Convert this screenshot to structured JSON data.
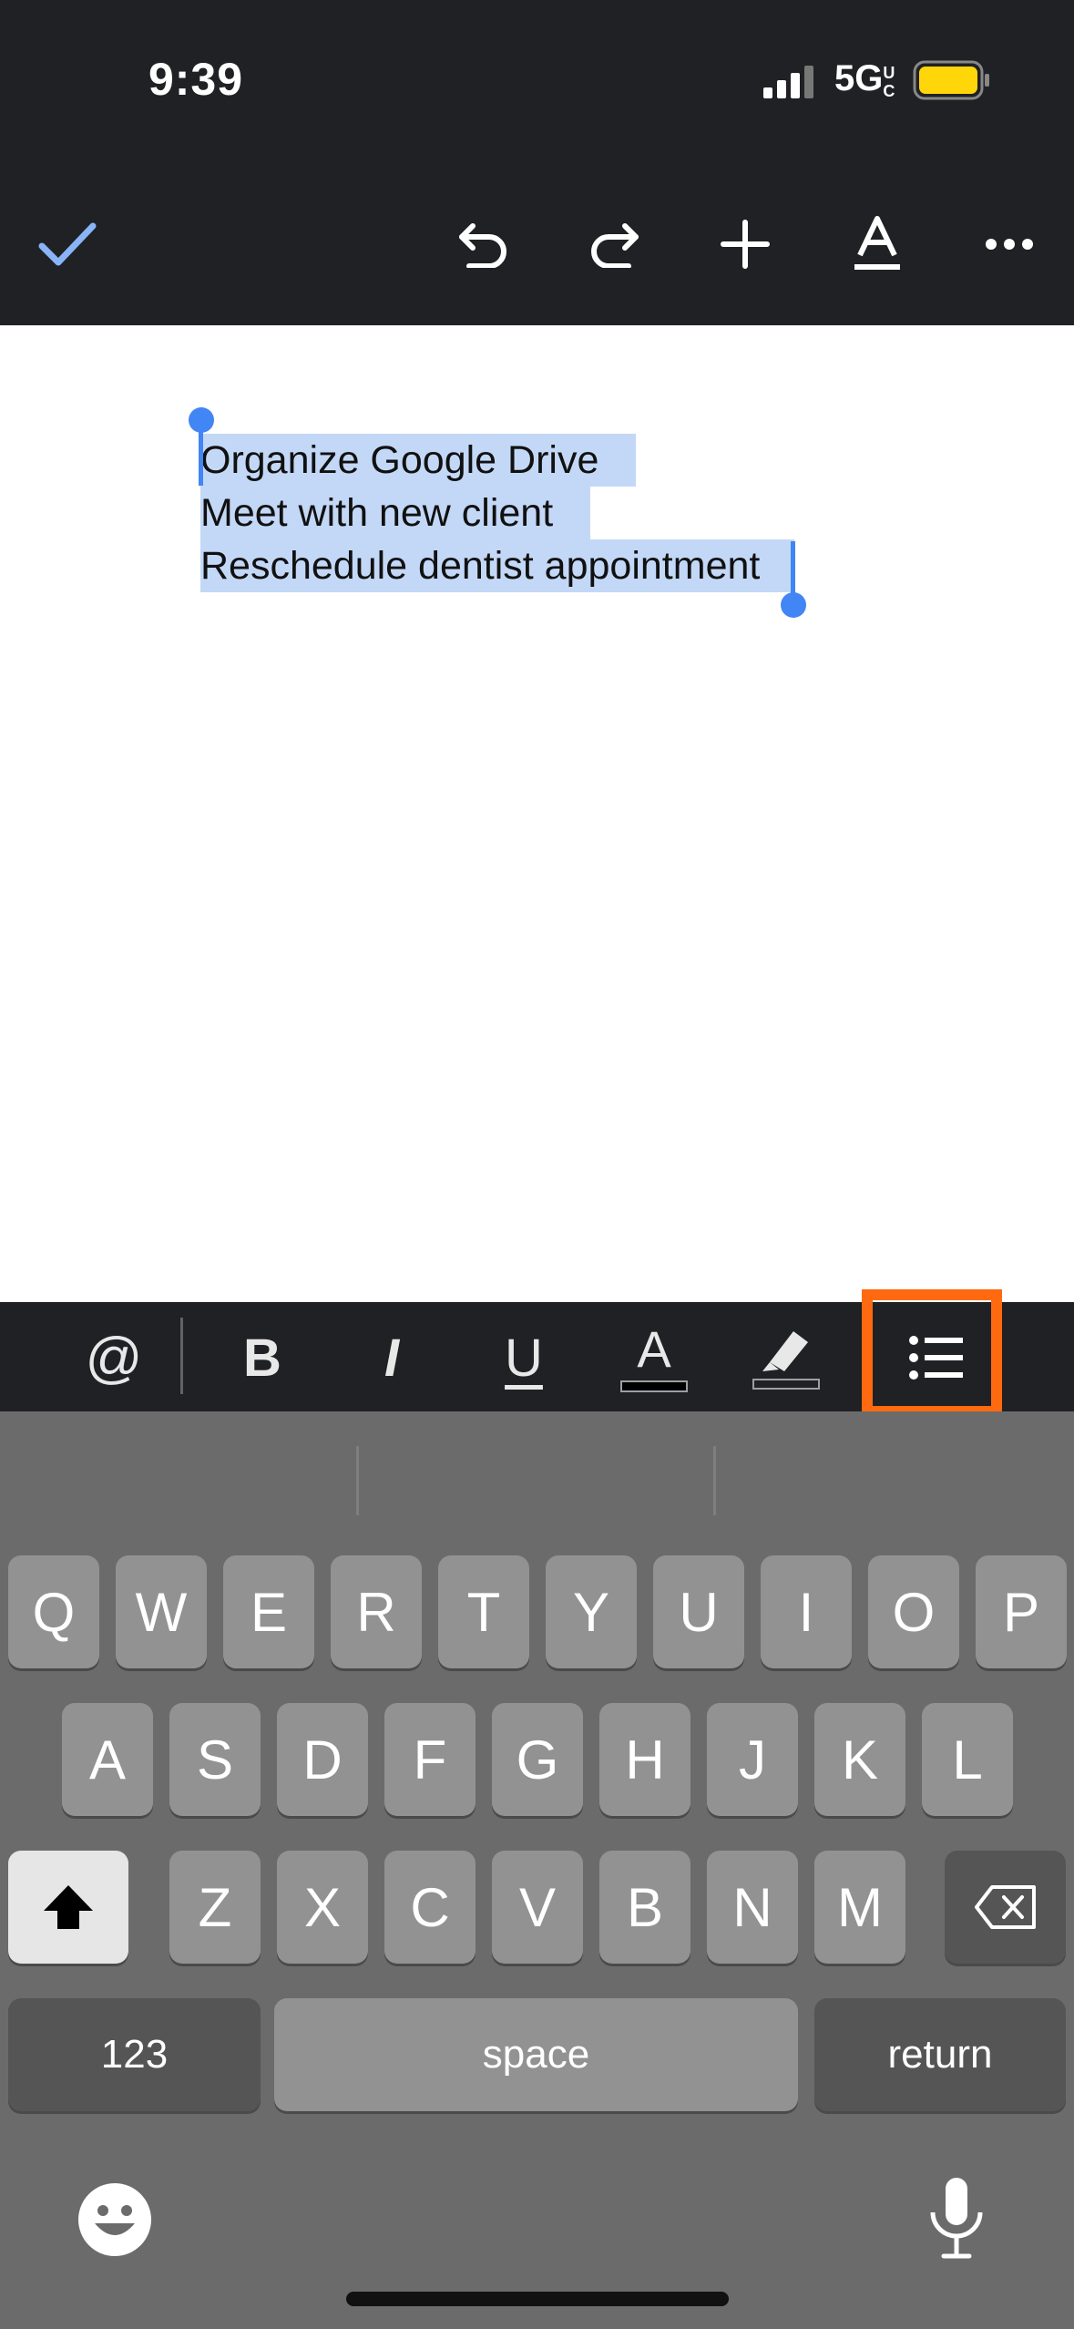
{
  "status_bar": {
    "time": "9:39",
    "network": "5G",
    "network_sub": "UC",
    "battery_color": "#ffd60a"
  },
  "toolbar": {
    "done": "checkmark-icon",
    "undo": "undo-icon",
    "redo": "redo-icon",
    "insert": "plus-icon",
    "text_format": "text-format-icon",
    "more": "more-icon",
    "accent": "#8ab4f8"
  },
  "document": {
    "lines": [
      "Organize Google Drive",
      "Meet with new client",
      "Reschedule dentist appointment"
    ],
    "selection_color": "#c3d8f7",
    "handle_color": "#4285f4"
  },
  "format_bar": {
    "mention": "@",
    "bold": "B",
    "italic": "I",
    "underline": "U",
    "text_color": "A",
    "highlight": "highlighter-icon",
    "list": "bulleted-list-icon",
    "highlight_box_color": "#ff6a10"
  },
  "keyboard": {
    "row1": [
      "Q",
      "W",
      "E",
      "R",
      "T",
      "Y",
      "U",
      "I",
      "O",
      "P"
    ],
    "row2": [
      "A",
      "S",
      "D",
      "F",
      "G",
      "H",
      "J",
      "K",
      "L"
    ],
    "row3": [
      "Z",
      "X",
      "C",
      "V",
      "B",
      "N",
      "M"
    ],
    "numbers": "123",
    "space": "space",
    "return": "return",
    "shift": "shift-icon",
    "delete": "backspace-icon",
    "emoji": "emoji-icon",
    "mic": "microphone-icon"
  }
}
